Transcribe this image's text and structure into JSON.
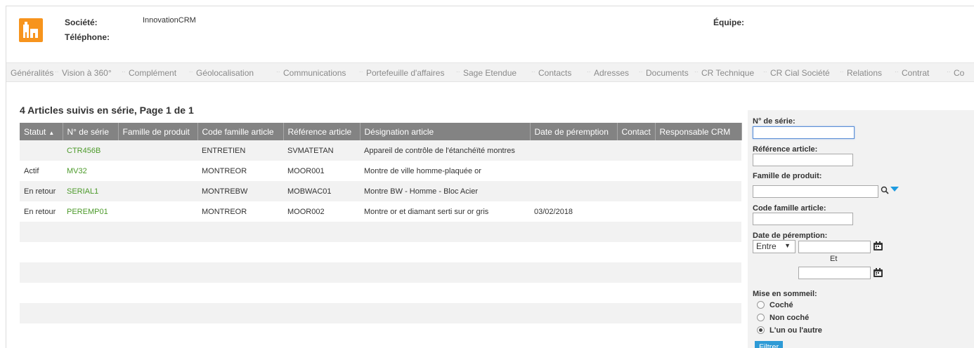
{
  "header": {
    "company_label": "Société:",
    "company_value": "InnovationCRM",
    "phone_label": "Téléphone:",
    "team_label": "Équipe:"
  },
  "tabs": [
    "Généralités",
    "Vision à 360°",
    "Complément",
    "Géolocalisation",
    "Communications",
    "Portefeuille d'affaires",
    "Sage Etendue",
    "Contacts",
    "Adresses",
    "Documents",
    "CR Technique",
    "CR Cial Société",
    "Relations",
    "Contrat",
    "Co"
  ],
  "list": {
    "title": "4 Articles suivis en série, Page 1 de 1",
    "columns": [
      "Statut",
      "N° de série",
      "Famille de produit",
      "Code famille article",
      "Référence article",
      "Désignation article",
      "Date de péremption",
      "Contact",
      "Responsable CRM"
    ],
    "sort_indicator": "▲",
    "rows": [
      [
        "",
        "CTR456B",
        "",
        "ENTRETIEN",
        "SVMATETAN",
        "Appareil de contrôle de l'étanchéïté montres",
        "",
        "",
        ""
      ],
      [
        "Actif",
        "MV32",
        "",
        "MONTREOR",
        "MOOR001",
        "Montre de ville homme-plaquée or",
        "",
        "",
        ""
      ],
      [
        "En retour",
        "SERIAL1",
        "",
        "MONTREBW",
        "MOBWAC01",
        "Montre BW - Homme - Bloc Acier",
        "",
        "",
        ""
      ],
      [
        "En retour",
        "PEREMP01",
        "",
        "MONTREOR",
        "MOOR002",
        "Montre or et diamant serti sur or gris",
        "03/02/2018",
        "",
        ""
      ]
    ]
  },
  "filters": {
    "serial_label": "N° de série:",
    "serial_value": "",
    "reference_label": "Référence article:",
    "family_label": "Famille de produit:",
    "code_family_label": "Code famille article:",
    "expiry_label": "Date de péremption:",
    "expiry_operator": "Entre",
    "and_label": "Et",
    "sleep_label": "Mise en sommeil:",
    "radio_checked_label": "Coché",
    "radio_unchecked_label": "Non coché",
    "radio_either_label": "L'un ou l'autre",
    "radio_selected": "either",
    "filter_button_first": "F",
    "filter_button_rest": "iltrer"
  },
  "colors": {
    "accent_orange": "#f7941d",
    "link_green": "#4c9a2a",
    "header_gray": "#838383",
    "button_blue": "#2d9ad6"
  }
}
